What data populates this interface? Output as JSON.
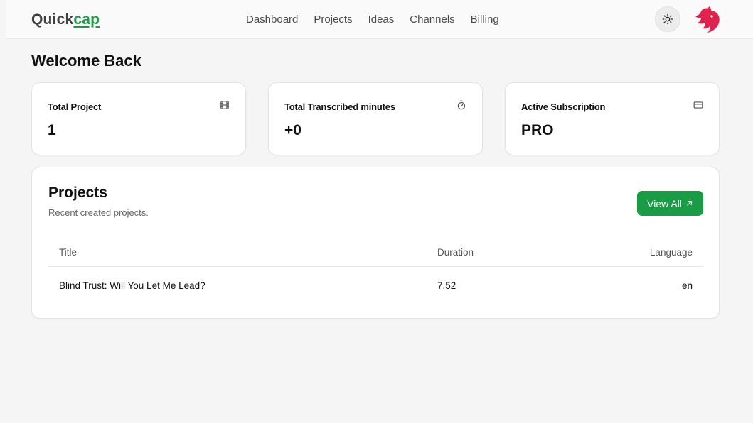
{
  "brand": {
    "name_part1": "Quick",
    "name_part2": "cap",
    "accent_color": "#1a9b46"
  },
  "nav": {
    "items": [
      {
        "label": "Dashboard"
      },
      {
        "label": "Projects"
      },
      {
        "label": "Ideas"
      },
      {
        "label": "Channels"
      },
      {
        "label": "Billing"
      }
    ]
  },
  "header": {
    "theme_icon": "sun-icon",
    "avatar_icon": "nestjs-logo"
  },
  "page": {
    "title": "Welcome Back"
  },
  "stats": [
    {
      "title": "Total Project",
      "value": "1",
      "icon": "film-icon"
    },
    {
      "title": "Total Transcribed minutes",
      "value": "+0",
      "icon": "timer-icon"
    },
    {
      "title": "Active Subscription",
      "value": "PRO",
      "icon": "credit-card-icon"
    }
  ],
  "projects": {
    "title": "Projects",
    "subtitle": "Recent created projects.",
    "view_all_label": "View All",
    "columns": {
      "title": "Title",
      "duration": "Duration",
      "language": "Language"
    },
    "rows": [
      {
        "title": "Blind Trust: Will You Let Me Lead?",
        "duration": "7.52",
        "language": "en"
      }
    ]
  }
}
